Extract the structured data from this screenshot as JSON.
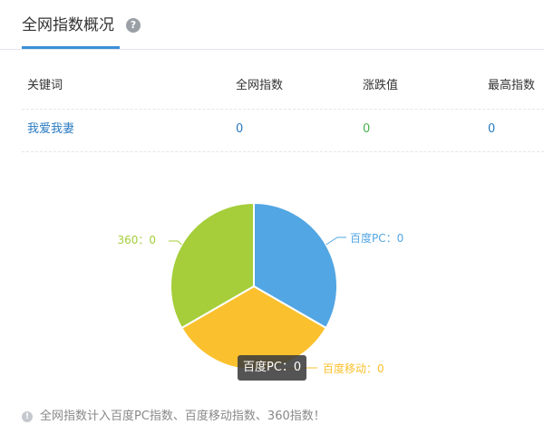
{
  "header": {
    "title": "全网指数概况",
    "help_icon": "question-circle-icon"
  },
  "table": {
    "columns": [
      "关键词",
      "全网指数",
      "涨跌值",
      "最高指数"
    ],
    "rows": [
      {
        "keyword": "我爱我妻",
        "index": "0",
        "change": "0",
        "max": "0"
      }
    ]
  },
  "chart_data": {
    "type": "pie",
    "series": [
      {
        "name": "百度PC",
        "value": 0,
        "share": 0.3333,
        "color": "#52a6e3",
        "label": "百度PC：0"
      },
      {
        "name": "百度移动",
        "value": 0,
        "share": 0.3333,
        "color": "#fbc02d",
        "label": "百度移动：0"
      },
      {
        "name": "360",
        "value": 0,
        "share": 0.3333,
        "color": "#a5ce3a",
        "label": "360：0"
      }
    ],
    "tooltip": "百度PC：0"
  },
  "note": {
    "icon": "info-circle-icon",
    "text": "全网指数计入百度PC指数、百度移动指数、360指数！"
  }
}
